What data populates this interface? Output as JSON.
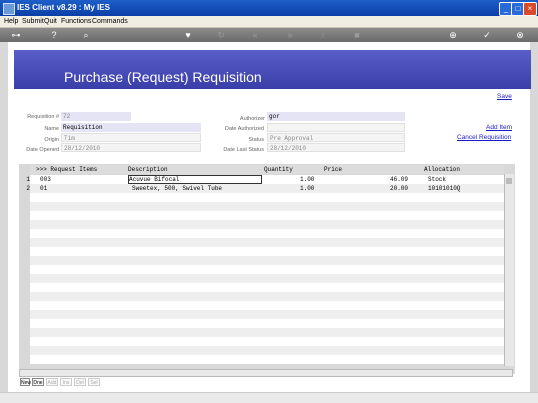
{
  "window": {
    "title": "IES Client v8.29 : My IES"
  },
  "menu": [
    "Help",
    "Submit",
    "Quit",
    "Functions",
    "Commands"
  ],
  "page": {
    "title": "Purchase (Request) Requisition"
  },
  "links": {
    "save": "Save",
    "add_item": "Add Item",
    "cancel_requisition": "Cancel Requisition"
  },
  "form": {
    "requisition_no": {
      "label": "Requisition #",
      "value": "72"
    },
    "name": {
      "label": "Name",
      "value": "Requisition"
    },
    "origin": {
      "label": "Origin",
      "value": "Tim"
    },
    "date_opened": {
      "label": "Date Opened",
      "value": "28/12/2010"
    },
    "authorizer": {
      "label": "Authorizer",
      "value": "gor"
    },
    "date_authorized": {
      "label": "Date Authorized",
      "value": ""
    },
    "status": {
      "label": "Status",
      "value": "Pre Approval"
    },
    "date_last_status": {
      "label": "Date Last Status",
      "value": "28/12/2010"
    }
  },
  "grid": {
    "headers": [
      ">>> Request Items",
      "Description",
      "Quantity",
      "Price",
      "Allocation"
    ],
    "rows": [
      {
        "num": "1",
        "item": "003",
        "description": "Acuvue Bifocal",
        "quantity": "1.00",
        "price": "46.09",
        "allocation": "Stock"
      },
      {
        "num": "2",
        "item": "01",
        "description": "Sweetex, 500, Swivel Tube",
        "quantity": "1.00",
        "price": "20.00",
        "allocation": "10101010Q"
      }
    ]
  },
  "bottom_tabs": [
    "New",
    "Dne",
    "Add",
    "Ins",
    "Del",
    "Sel"
  ]
}
